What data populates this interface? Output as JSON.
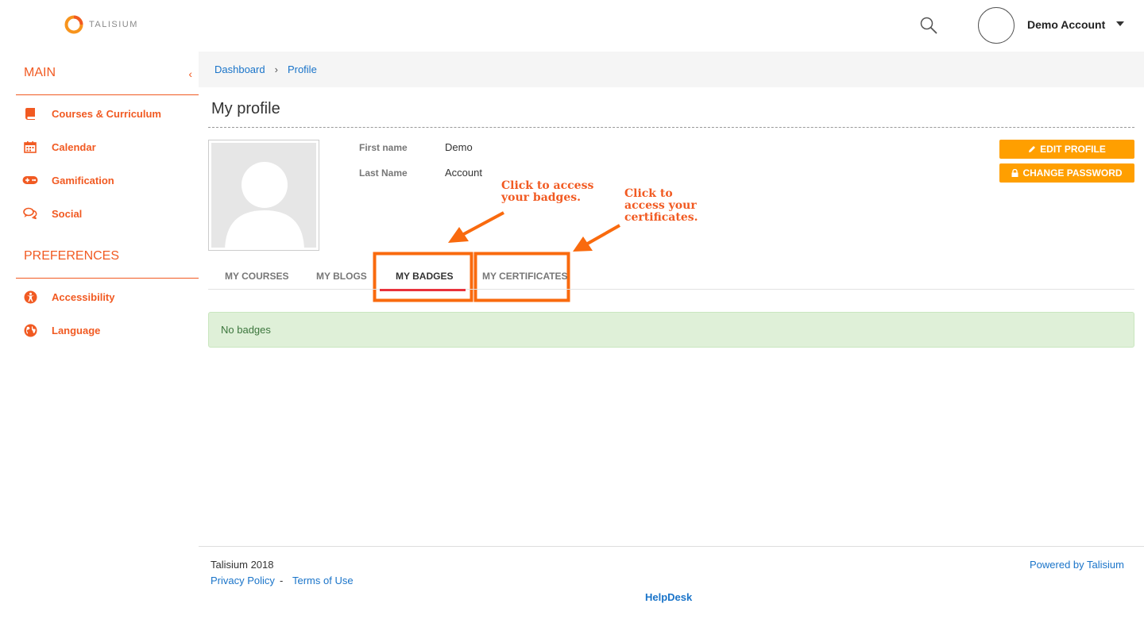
{
  "header": {
    "logo_text": "TALISIUM",
    "user_name": "Demo Account"
  },
  "sidebar": {
    "main_title": "MAIN",
    "main_items": [
      {
        "label": "Courses & Curriculum",
        "icon": "book-icon"
      },
      {
        "label": "Calendar",
        "icon": "calendar-icon"
      },
      {
        "label": "Gamification",
        "icon": "gamepad-icon"
      },
      {
        "label": "Social",
        "icon": "comments-icon"
      }
    ],
    "preferences_title": "PREFERENCES",
    "preference_items": [
      {
        "label": "Accessibility",
        "icon": "accessibility-icon"
      },
      {
        "label": "Language",
        "icon": "globe-icon"
      }
    ]
  },
  "breadcrumb": {
    "items": [
      "Dashboard",
      "Profile"
    ],
    "separator": "›"
  },
  "profile": {
    "title": "My profile",
    "first_name_label": "First name",
    "first_name": "Demo",
    "last_name_label": "Last Name",
    "last_name": "Account",
    "edit_button": "EDIT PROFILE",
    "password_button": "CHANGE PASSWORD"
  },
  "tabs": {
    "items": [
      "MY COURSES",
      "MY BLOGS",
      "MY BADGES",
      "MY CERTIFICATES"
    ],
    "active": "MY BADGES"
  },
  "annotations": {
    "badges_line1": "Click to access",
    "badges_line2": "your badges.",
    "certs_line1": "Click to",
    "certs_line2": "access your",
    "certs_line3": "certificates."
  },
  "alert": {
    "message": "No badges"
  },
  "footer": {
    "copyright": "Talisium 2018",
    "privacy": "Privacy Policy",
    "dash": "-",
    "terms": "Terms of Use",
    "helpdesk": "HelpDesk",
    "powered": "Powered by Talisium"
  },
  "colors": {
    "brand": "#f15a22",
    "button": "#ff9f00",
    "link": "#1a74c9",
    "tab_underline": "#e8323c",
    "alert_bg": "#dff0d8"
  }
}
